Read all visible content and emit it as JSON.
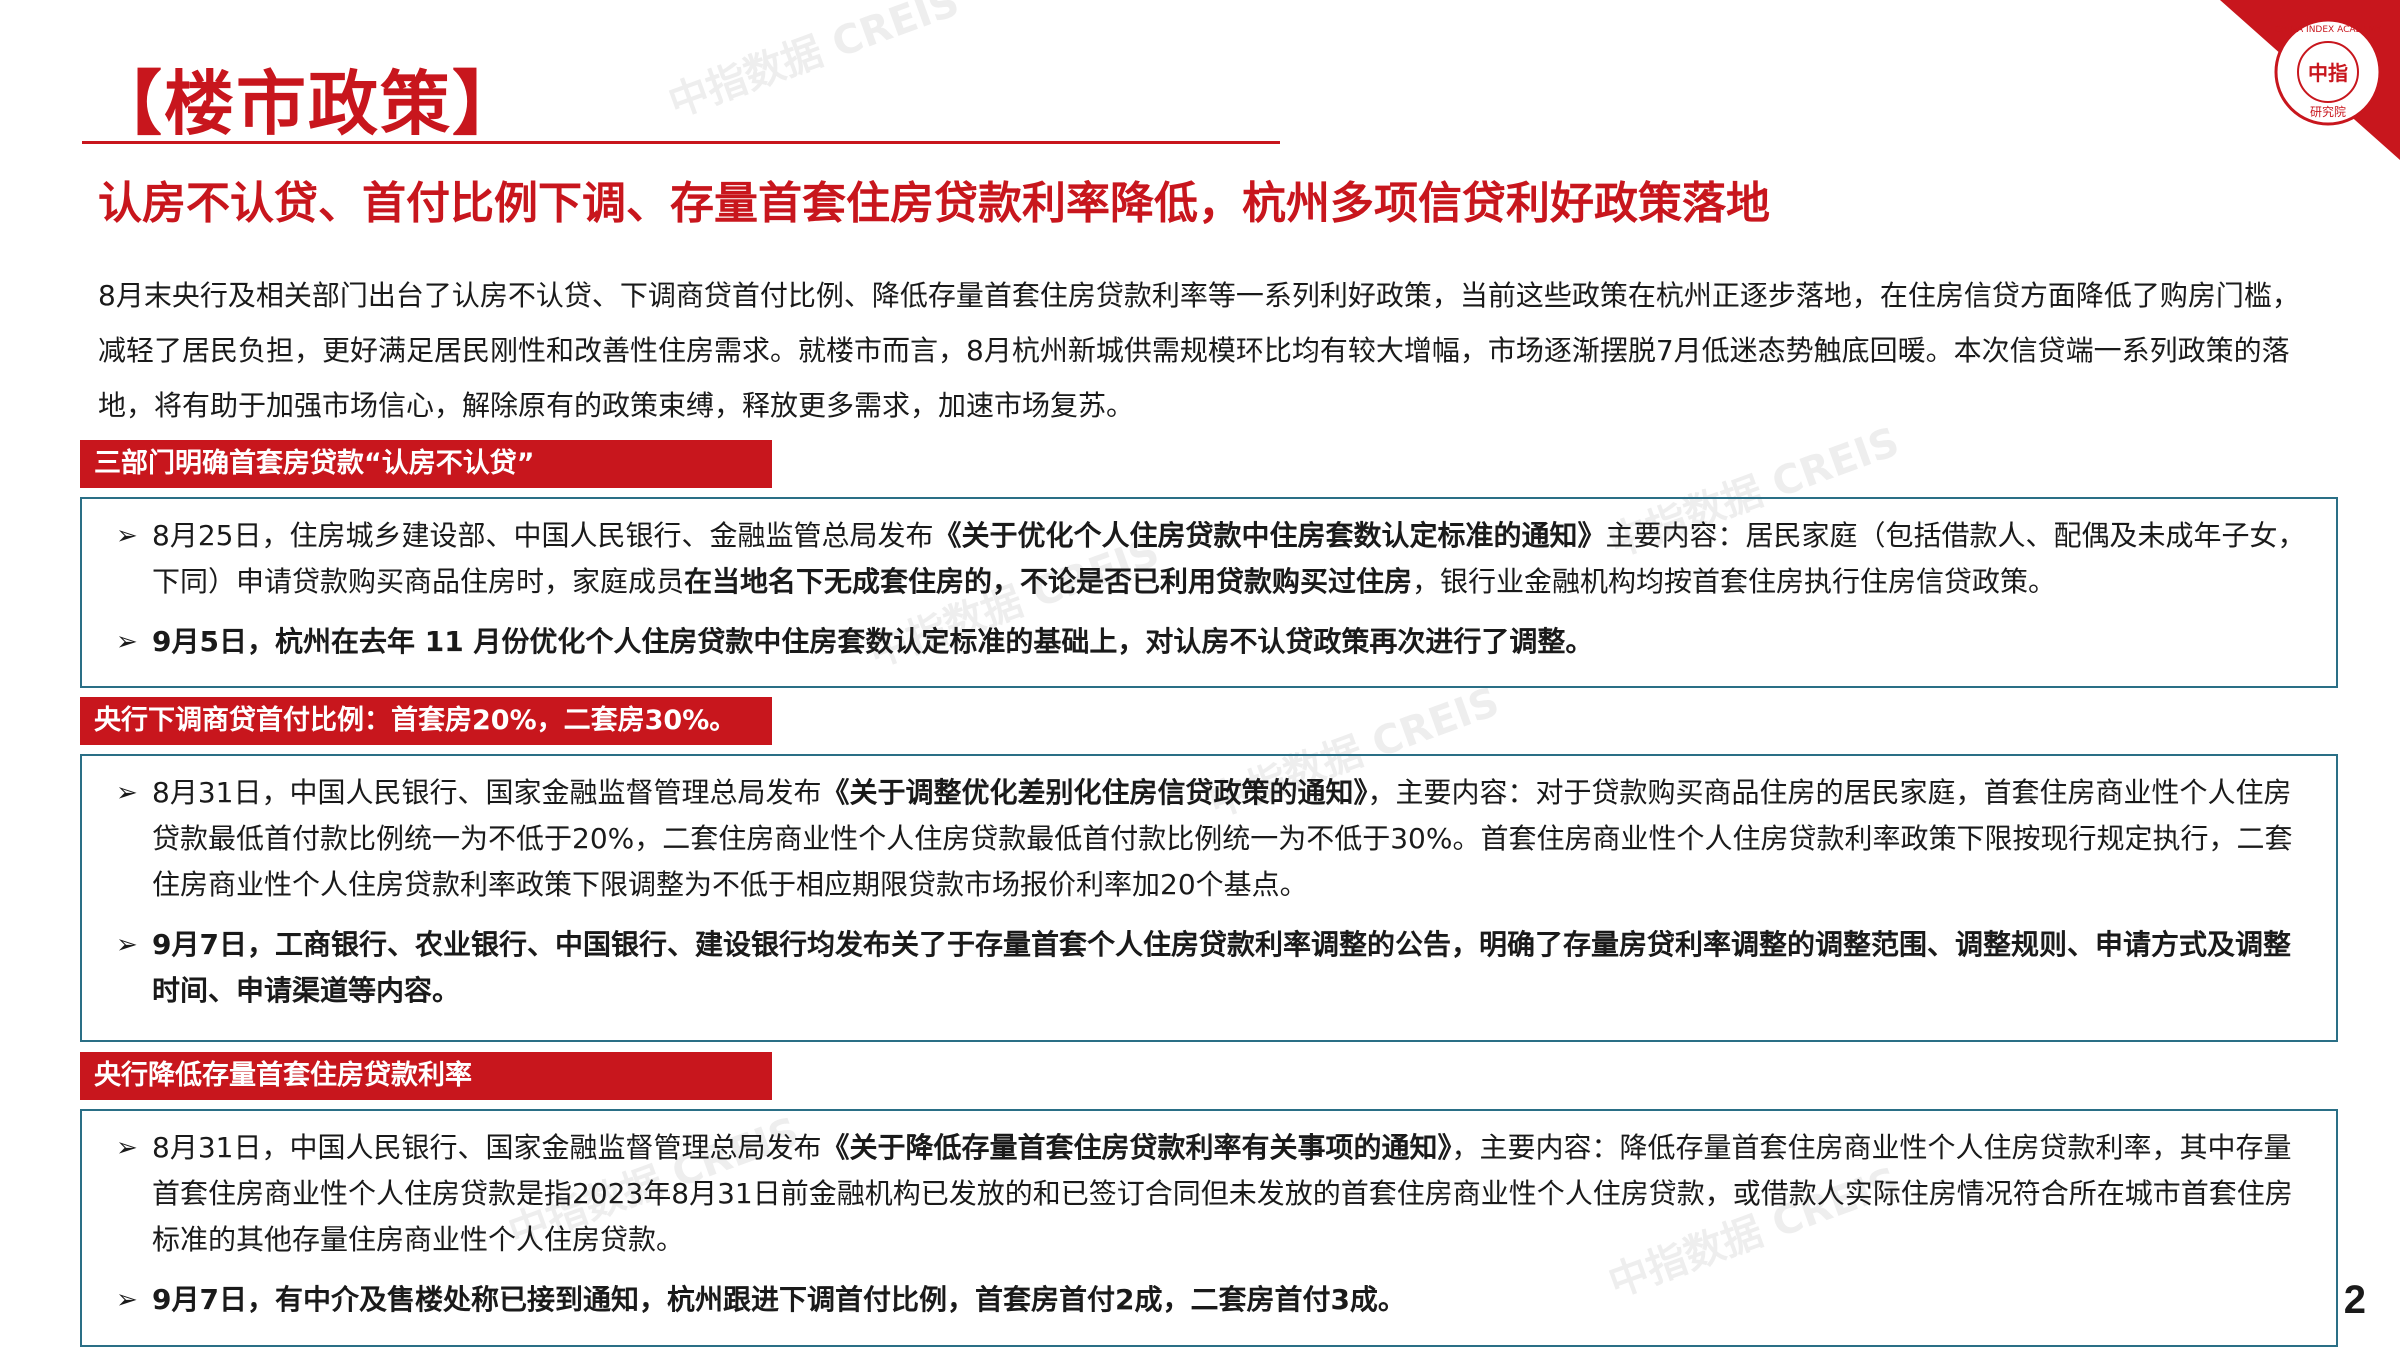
{
  "title": "【楼市政策】",
  "headline": "认房不认贷、首付比例下调、存量首套住房贷款利率降低，杭州多项信贷利好政策落地",
  "intro": "8月末央行及相关部门出台了认房不认贷、下调商贷首付比例、降低存量首套住房贷款利率等一系列利好政策，当前这些政策在杭州正逐步落地，在住房信贷方面降低了购房门槛，减轻了居民负担，更好满足居民刚性和改善性住房需求。就楼市而言，8月杭州新城供需规模环比均有较大增幅，市场逐渐摆脱7月低迷态势触底回暖。本次信贷端一系列政策的落地，将有助于加强市场信心，解除原有的政策束缚，释放更多需求，加速市场复苏。",
  "logo": {
    "ring_text": "CHINA INDEX ACADEMY",
    "center_text": "中指",
    "bottom_text": "研究院"
  },
  "watermark": {
    "cn": "中指数据",
    "en": "CREIS"
  },
  "sections": [
    {
      "label": "三部门明确首套房贷款“认房不认贷”",
      "items": [
        {
          "parts": [
            {
              "text": "8月25日，住房城乡建设部、中国人民银行、金融监管总局发布",
              "bold": false
            },
            {
              "text": "《关于优化个人住房贷款中住房套数认定标准的通知》",
              "bold": true
            },
            {
              "text": "主要内容：居民家庭（包括借款人、配偶及未成年子女，下同）申请贷款购买商品住房时，家庭成员",
              "bold": false
            },
            {
              "text": "在当地名下无成套住房的，不论是否已利用贷款购买过住房",
              "bold": true
            },
            {
              "text": "，银行业金融机构均按首套住房执行住房信贷政策。",
              "bold": false
            }
          ]
        },
        {
          "parts": [
            {
              "text": "9月5日，杭州在去年 11 月份优化个人住房贷款中住房套数认定标准的基础上，对认房不认贷政策再次进行了调整。",
              "bold": true
            }
          ]
        }
      ]
    },
    {
      "label": "央行下调商贷首付比例：首套房20%，二套房30%。",
      "items": [
        {
          "parts": [
            {
              "text": "8月31日，中国人民银行、国家金融监督管理总局发布",
              "bold": false
            },
            {
              "text": "《关于调整优化差别化住房信贷政策的通知》",
              "bold": true
            },
            {
              "text": "，主要内容：对于贷款购买商品住房的居民家庭，首套住房商业性个人住房贷款最低首付款比例统一为不低于20%，二套住房商业性个人住房贷款最低首付款比例统一为不低于30%。首套住房商业性个人住房贷款利率政策下限按现行规定执行，二套住房商业性个人住房贷款利率政策下限调整为不低于相应期限贷款市场报价利率加20个基点。",
              "bold": false
            }
          ]
        },
        {
          "parts": [
            {
              "text": "9月7日，工商银行、农业银行、中国银行、建设银行均发布关了于存量首套个人住房贷款利率调整的公告，明确了存量房贷利率调整的调整范围、调整规则、申请方式及调整时间、申请渠道等内容。",
              "bold": true
            }
          ]
        }
      ]
    },
    {
      "label": "央行降低存量首套住房贷款利率",
      "items": [
        {
          "parts": [
            {
              "text": "8月31日，中国人民银行、国家金融监督管理总局发布",
              "bold": false
            },
            {
              "text": "《关于降低存量首套住房贷款利率有关事项的通知》",
              "bold": true
            },
            {
              "text": "，主要内容：降低存量首套住房商业性个人住房贷款利率，其中存量首套住房商业性个人住房贷款是指2023年8月31日前金融机构已发放的和已签订合同但未发放的首套住房商业性个人住房贷款，或借款人实际住房情况符合所在城市首套住房标准的其他存量住房商业性个人住房贷款。",
              "bold": false
            }
          ]
        },
        {
          "parts": [
            {
              "text": "9月7日，有中介及售楼处称已接到通知，杭州跟进下调首付比例，首套房首付2成，二套房首付3成。",
              "bold": true
            }
          ]
        }
      ]
    }
  ],
  "page_number": "2",
  "colors": {
    "accent": "#c8161d",
    "box_border": "#2a6f86",
    "text": "#1a1a1a"
  }
}
